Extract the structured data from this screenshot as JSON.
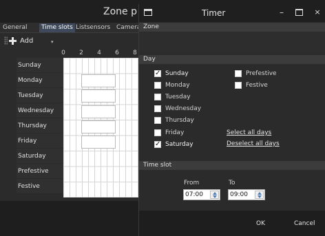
{
  "background_window": {
    "title": "Zone p",
    "tabs": [
      {
        "label": "General"
      },
      {
        "label": "Time slots"
      },
      {
        "label": "Listsensors"
      },
      {
        "label": "Camera"
      }
    ],
    "toolbar": {
      "add_label": "Add"
    },
    "hours": [
      "0",
      "2",
      "4",
      "6",
      "8"
    ],
    "days": [
      "Sunday",
      "Monday",
      "Tuesday",
      "Wednesday",
      "Thursday",
      "Friday",
      "Saturday",
      "Prefestive",
      "Festive"
    ]
  },
  "dialog": {
    "title": "Timer",
    "window_buttons": {
      "minimize": "–",
      "close": "×"
    },
    "zone_header": "Zone",
    "day_header": "Day",
    "days_left": [
      {
        "label": "Sunday",
        "checked": true
      },
      {
        "label": "Monday",
        "checked": false
      },
      {
        "label": "Tuesday",
        "checked": false
      },
      {
        "label": "Wednesday",
        "checked": false
      },
      {
        "label": "Thursday",
        "checked": false
      },
      {
        "label": "Friday",
        "checked": false
      },
      {
        "label": "Saturday",
        "checked": true
      }
    ],
    "days_right": [
      {
        "label": "Prefestive",
        "checked": false
      },
      {
        "label": "Festive",
        "checked": false
      }
    ],
    "select_all": "Select all days",
    "deselect_all": "Deselect all days",
    "time_slot_header": "Time slot",
    "from_label": "From",
    "to_label": "To",
    "from_value": "07:00",
    "to_value": "09:00",
    "ok_label": "OK",
    "cancel_label": "Cancel"
  },
  "icons": {
    "add": "plus-icon",
    "app": "window-icon",
    "spinner": "spinner-arrows-icon"
  },
  "colors": {
    "window_bg": "#2b2b2b",
    "titlebar": "#1f1f1f",
    "section_header": "#3c3c3c",
    "active_tab": "#3e4a5c",
    "spinner_arrow": "#4a7ab8"
  }
}
